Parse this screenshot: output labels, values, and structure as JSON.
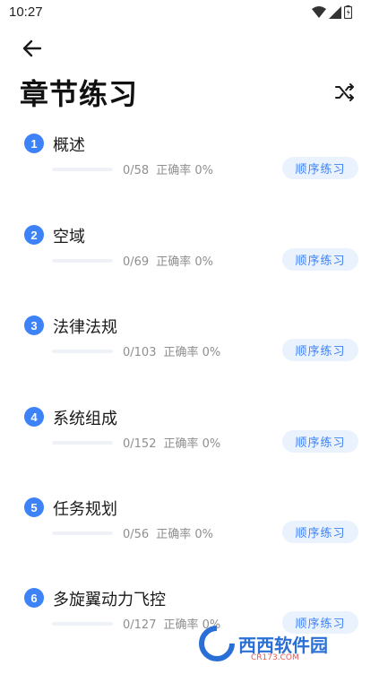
{
  "status_bar": {
    "time": "10:27"
  },
  "header": {
    "title": "章节练习"
  },
  "colors": {
    "accent": "#3e82f7",
    "button_bg": "#eaf2fd"
  },
  "chapters": [
    {
      "number": "1",
      "title": "概述",
      "done": "0/58",
      "accuracy": "正确率 0%",
      "action": "顺序练习",
      "progress": 0
    },
    {
      "number": "2",
      "title": "空域",
      "done": "0/69",
      "accuracy": "正确率 0%",
      "action": "顺序练习",
      "progress": 0
    },
    {
      "number": "3",
      "title": "法律法规",
      "done": "0/103",
      "accuracy": "正确率 0%",
      "action": "顺序练习",
      "progress": 0
    },
    {
      "number": "4",
      "title": "系统组成",
      "done": "0/152",
      "accuracy": "正确率 0%",
      "action": "顺序练习",
      "progress": 0
    },
    {
      "number": "5",
      "title": "任务规划",
      "done": "0/56",
      "accuracy": "正确率 0%",
      "action": "顺序练习",
      "progress": 0
    },
    {
      "number": "6",
      "title": "多旋翼动力飞控",
      "done": "0/127",
      "accuracy": "正确率 0%",
      "action": "顺序练习",
      "progress": 0
    }
  ],
  "watermark": {
    "text": "西西软件园",
    "sub": "CR173.COM"
  }
}
